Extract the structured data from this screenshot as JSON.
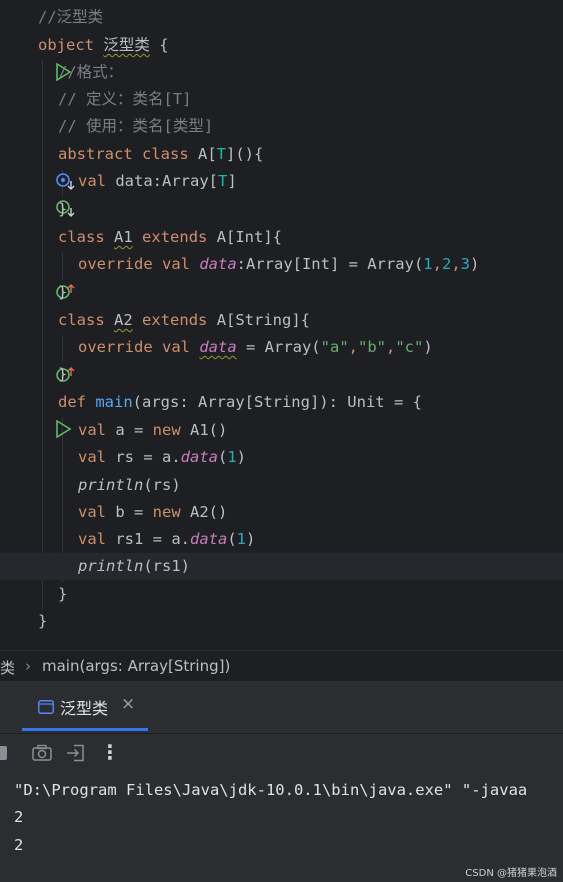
{
  "editor": {
    "lines": {
      "l1": [
        "//泛型类"
      ],
      "l2": [
        "object",
        " ",
        "泛型类",
        " {"
      ],
      "l3": [
        "//格式："
      ],
      "l4": [
        "// 定义：类名[T]"
      ],
      "l5": [
        "// 使用：类名[类型]"
      ],
      "l6": [
        "abstract class",
        " A[",
        "T",
        "](){"
      ],
      "l7": [
        "val",
        " data:Array[",
        "T",
        "]"
      ],
      "l8": [
        "}"
      ],
      "l9": [
        "class",
        " ",
        "A1",
        " ",
        "extends",
        " A[Int]{"
      ],
      "l10": [
        "override val",
        " ",
        "data",
        ":Array[Int] = Array(",
        "1",
        ",",
        "2",
        ",",
        "3",
        ")"
      ],
      "l11": [
        "}"
      ],
      "l12": [
        "class",
        " ",
        "A2",
        " ",
        "extends",
        " A[String]{"
      ],
      "l13": [
        "override val",
        " ",
        "data",
        " = Array(",
        "\"a\"",
        ",",
        "\"b\"",
        ",",
        "\"c\"",
        ")"
      ],
      "l14": [
        "}"
      ],
      "l15": [
        "def",
        " ",
        "main",
        "(args: Array[String]): Unit = {"
      ],
      "l16": [
        "val",
        " a = ",
        "new",
        " A1()"
      ],
      "l17": [
        "val",
        " rs = a.",
        "data",
        "(",
        "1",
        ")"
      ],
      "l18": [
        "println",
        "(rs)"
      ],
      "l19": [
        "val",
        " b = ",
        "new",
        " A2()"
      ],
      "l20": [
        "val",
        " rs1 = a.",
        "data",
        "(",
        "1",
        ")"
      ],
      "l21": [
        "println",
        "(rs1)"
      ],
      "l22": [
        "}"
      ],
      "l23": [
        "}"
      ]
    }
  },
  "breadcrumb": {
    "item1": "类",
    "separator": "›",
    "item2": "main(args: Array[String])"
  },
  "run_panel": {
    "tab_label": "泛型类",
    "close_glyph": "×",
    "more_glyph": "⋮",
    "console_lines": [
      "\"D:\\Program Files\\Java\\jdk-10.0.1\\bin\\java.exe\" \"-javaa",
      "2",
      "2"
    ]
  },
  "watermark": "CSDN @猪猪果泡酒",
  "colors": {
    "background": "#1e1f22",
    "keyword": "#cf8e6d",
    "comment": "#7a7e85",
    "function": "#56a8f5",
    "number": "#2aacb8",
    "string": "#6aab73",
    "type_param": "#16baac",
    "property": "#c77dbb",
    "accent": "#3574f0"
  },
  "icons": {
    "run_object": "run-triangle-icon",
    "run_main": "run-triangle-icon",
    "implemented": "implemented-down-icon",
    "override": "override-up-icon",
    "bulb": "lightbulb-icon"
  }
}
